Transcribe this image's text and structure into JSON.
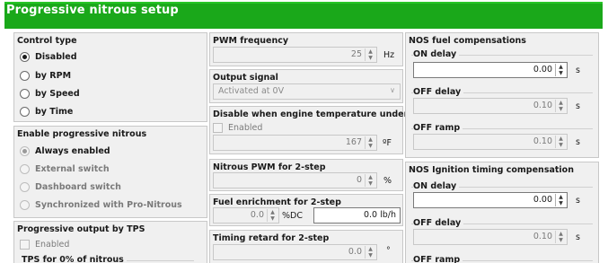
{
  "window": {
    "title": "Progressive nitrous setup"
  },
  "control_type": {
    "header": "Control type",
    "options": [
      "Disabled",
      "by RPM",
      "by Speed",
      "by Time"
    ],
    "selected": "Disabled"
  },
  "enable_progressive": {
    "header": "Enable progressive nitrous",
    "options": [
      "Always enabled",
      "External switch",
      "Dashboard switch",
      "Synchronized with Pro-Nitrous"
    ],
    "selected": "Always enabled"
  },
  "progressive_output_tps": {
    "header": "Progressive output by TPS",
    "enabled_label": "Enabled",
    "sub_label": "TPS for 0% of nitrous"
  },
  "pwm_frequency": {
    "header": "PWM frequency",
    "value": "25",
    "unit": "Hz"
  },
  "output_signal": {
    "header": "Output signal",
    "value": "Activated at 0V",
    "chevron": "∨"
  },
  "disable_engine_temp": {
    "header": "Disable when engine temperature under",
    "enabled_label": "Enabled",
    "value": "167",
    "unit": "ºF"
  },
  "nitrous_pwm_2step": {
    "header": "Nitrous PWM for 2-step",
    "value": "0",
    "unit": "%"
  },
  "fuel_enrichment_2step": {
    "header": "Fuel enrichment for 2-step",
    "value": "0.0",
    "unit": "%DC",
    "value2": "0.0 lb/h"
  },
  "timing_retard_2step": {
    "header": "Timing retard for 2-step",
    "value": "0.0",
    "unit": "°"
  },
  "nos_fuel_comp": {
    "header": "NOS fuel compensations",
    "on_delay_label": "ON delay",
    "on_delay_value": "0.00",
    "on_delay_unit": "s",
    "off_delay_label": "OFF delay",
    "off_delay_value": "0.10",
    "off_delay_unit": "s",
    "off_ramp_label": "OFF ramp",
    "off_ramp_value": "0.10",
    "off_ramp_unit": "s"
  },
  "nos_ign_comp": {
    "header": "NOS Ignition timing compensation",
    "on_delay_label": "ON delay",
    "on_delay_value": "0.00",
    "on_delay_unit": "s",
    "off_delay_label": "OFF delay",
    "off_delay_value": "0.10",
    "off_delay_unit": "s",
    "off_ramp_label": "OFF ramp"
  },
  "icons": {
    "spin_up": "▲",
    "spin_down": "▼"
  }
}
